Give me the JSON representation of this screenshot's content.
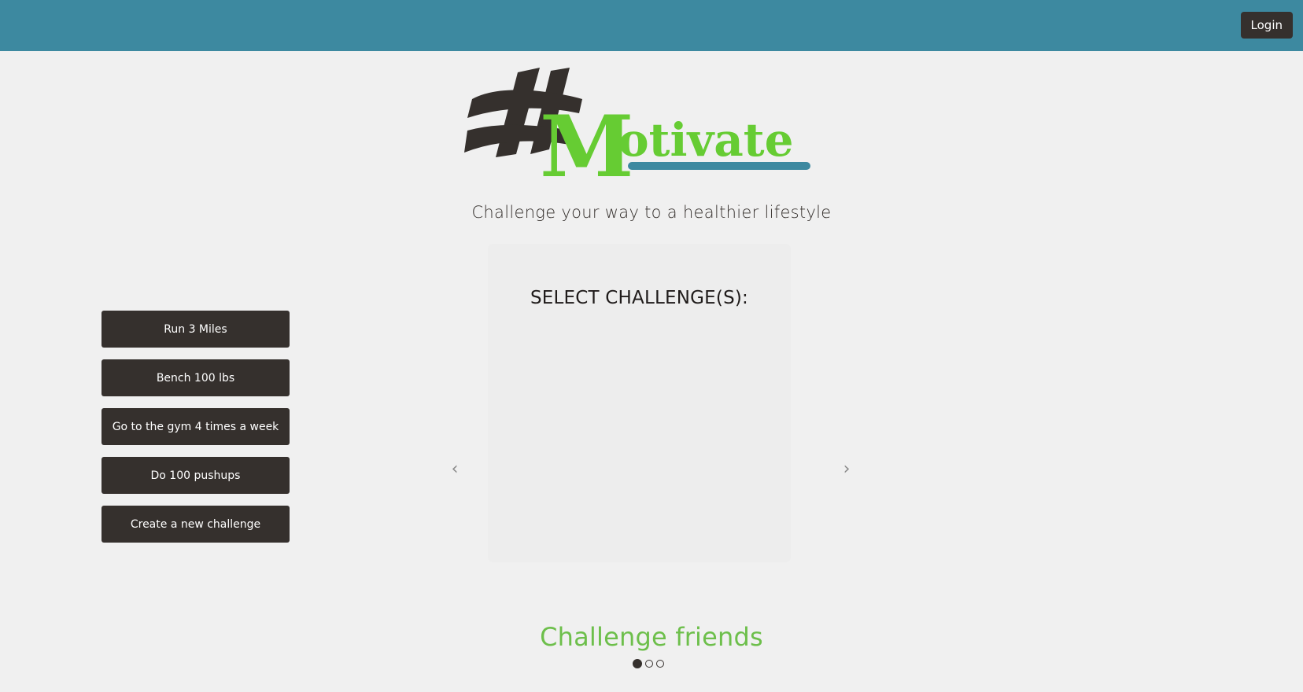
{
  "header": {
    "login_label": "Login"
  },
  "logo": {
    "text_hash": "#",
    "text_word": "Motivate",
    "colors": {
      "hash": "#35302d",
      "word": "#66cc33",
      "underline": "#3d89a0"
    }
  },
  "tagline": "Challenge your way to a healthier lifestyle",
  "carousel": {
    "panel_title": "SELECT CHALLENGE(S):",
    "challenges": [
      {
        "label": "Run 3 Miles"
      },
      {
        "label": "Bench 100 lbs"
      },
      {
        "label": "Go to the gym 4 times a week"
      },
      {
        "label": "Do 100 pushups"
      },
      {
        "label": "Create a new challenge"
      }
    ],
    "prev_icon": "chevron-left-icon",
    "next_icon": "chevron-right-icon",
    "prev_glyph": "‹",
    "next_glyph": "›",
    "caption": "Challenge friends",
    "active_slide": 1,
    "slide_count": 3
  },
  "colors": {
    "topbar": "#3d89a0",
    "button": "#35302d",
    "caption": "#6dbf4b",
    "background": "#f0f0f0"
  }
}
